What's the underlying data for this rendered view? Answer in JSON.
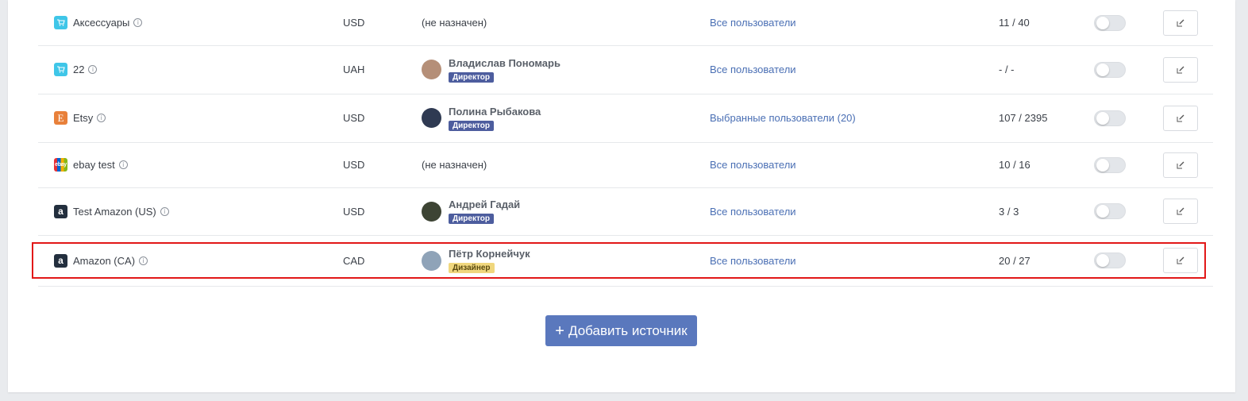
{
  "rows": [
    {
      "name": "Аксессуары",
      "icon": "cart-icon",
      "currency": "USD",
      "responsible": "(не назначен)",
      "role": "",
      "access": "Все пользователи",
      "count": "11 / 40"
    },
    {
      "name": "22",
      "icon": "cart-icon",
      "currency": "UAH",
      "responsible": "Владислав Пономарь",
      "role": "Директор",
      "access": "Все пользователи",
      "count": "- / -"
    },
    {
      "name": "Etsy",
      "icon": "etsy-icon",
      "icon_text": "E",
      "currency": "USD",
      "responsible": "Полина Рыбакова",
      "role": "Директор",
      "access": "Выбранные пользователи (20)",
      "count": "107 / 2395"
    },
    {
      "name": "ebay test",
      "icon": "ebay-icon",
      "icon_text": "ebay",
      "currency": "USD",
      "responsible": "(не назначен)",
      "role": "",
      "access": "Все пользователи",
      "count": "10 / 16"
    },
    {
      "name": "Test Amazon (US)",
      "icon": "amazon-icon",
      "icon_text": "a",
      "currency": "USD",
      "responsible": "Андрей Гадай",
      "role": "Директор",
      "access": "Все пользователи",
      "count": "3 / 3"
    },
    {
      "name": "Amazon (CA)",
      "icon": "amazon-icon",
      "icon_text": "a",
      "currency": "CAD",
      "responsible": "Пётр Корнейчук",
      "role": "Дизайнер",
      "access": "Все пользователи",
      "count": "20 / 27"
    }
  ],
  "add_button": {
    "icon": "+",
    "label": "Добавить источник"
  },
  "colors": {
    "accent": "#5a78bd",
    "link": "#4a6fb4",
    "badge_director": "#4d5d9e",
    "badge_designer": "#f0d77e",
    "highlight": "#e21818"
  }
}
